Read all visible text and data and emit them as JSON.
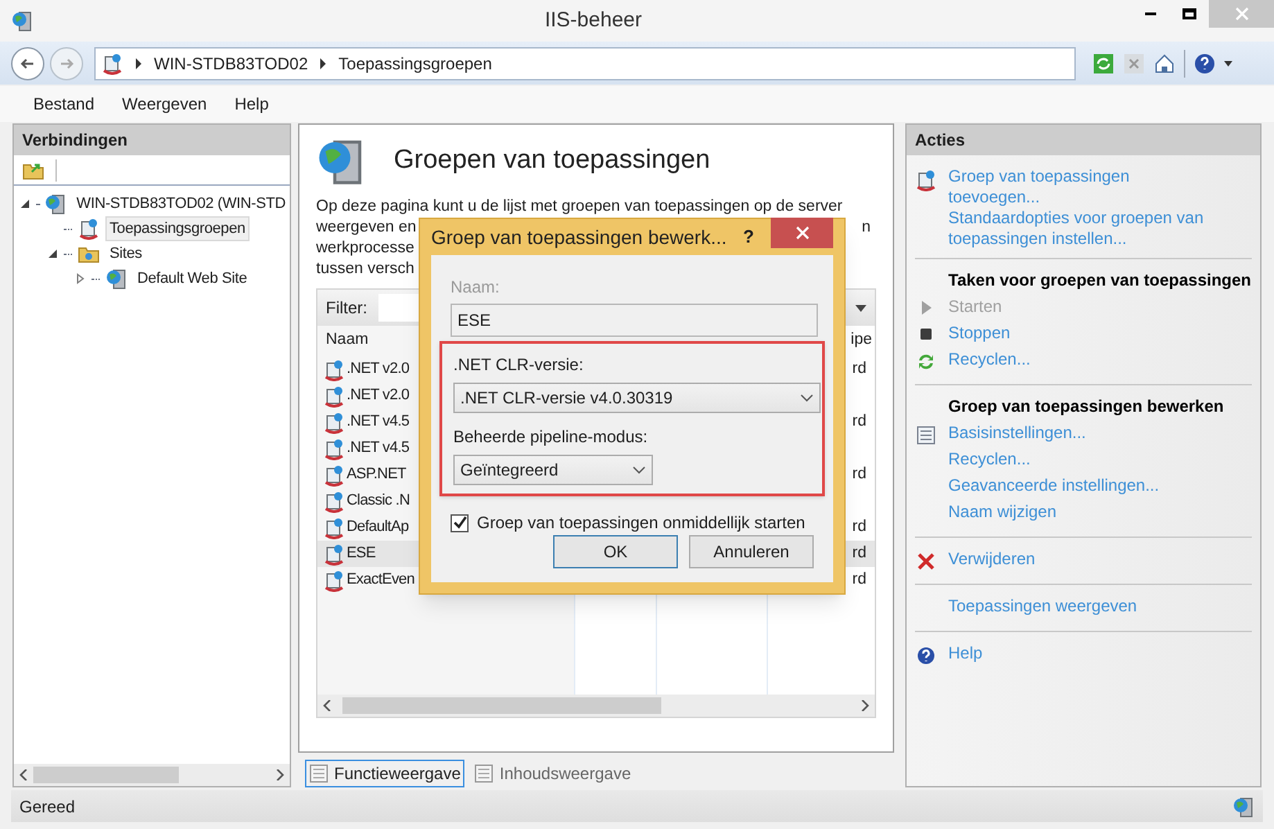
{
  "window": {
    "title": "IIS-beheer"
  },
  "address": {
    "crumbs": [
      "WIN-STDB83TOD02",
      "Toepassingsgroepen"
    ]
  },
  "menu": [
    "Bestand",
    "Weergeven",
    "Help"
  ],
  "connections": {
    "title": "Verbindingen",
    "tree": [
      {
        "label": "WIN-STDB83TOD02 (WIN-STD",
        "expanded": true,
        "selected": false,
        "children": [
          {
            "label": "Toepassingsgroepen",
            "selected": true
          },
          {
            "label": "Sites",
            "expanded": true,
            "selected": false,
            "children": [
              {
                "label": "Default Web Site",
                "expanded": false,
                "selected": false
              }
            ]
          }
        ]
      }
    ]
  },
  "main": {
    "title": "Groepen van toepassingen",
    "description": {
      "line_1": "Op deze pagina kunt u de lijst met groepen van toepassingen op de server",
      "line_2": "weergeven en",
      "line_2_end": "n",
      "line_3": "werkprocesse",
      "line_4": "tussen versch"
    },
    "filter": {
      "label": "Filter:"
    },
    "table": {
      "columns": [
        "Naam",
        "ipe"
      ],
      "rows": [
        {
          "name": ".NET v2.0",
          "column_4": "rd",
          "selected": false
        },
        {
          "name": ".NET v2.0",
          "selected": false
        },
        {
          "name": ".NET v4.5",
          "column_4": "rd",
          "selected": false
        },
        {
          "name": ".NET v4.5",
          "selected": false
        },
        {
          "name": "ASP.NET",
          "column_4": "rd",
          "selected": false
        },
        {
          "name": "Classic .N",
          "selected": false
        },
        {
          "name": "DefaultAp",
          "column_4": "rd",
          "selected": false
        },
        {
          "name": "ESE",
          "column_4": "rd",
          "selected": true
        },
        {
          "name": "ExactEven",
          "column_4": "rd",
          "selected": false
        }
      ]
    },
    "view_tabs": [
      {
        "label": "Functieweergave",
        "selected": true
      },
      {
        "label": "Inhoudsweergave",
        "selected": false
      }
    ]
  },
  "dialog": {
    "title": "Groep van toepassingen bewerk...",
    "help": "?",
    "name_label": "Naam:",
    "name_value": "ESE",
    "clr_label": ".NET CLR-versie:",
    "clr_value": ".NET CLR-versie v4.0.30319",
    "pipeline_label": "Beheerde pipeline-modus:",
    "pipeline_value": "Geïntegreerd",
    "start_checkbox": {
      "label": "Groep van toepassingen onmiddellijk starten",
      "checked": true
    },
    "buttons": [
      "OK",
      "Annuleren"
    ]
  },
  "actions": {
    "title": "Acties",
    "groups": [
      {
        "items": [
          {
            "label": "Groep van toepassingen toevoegen...",
            "kind": "link",
            "disabled": false
          },
          {
            "label": "Standaardopties voor groepen van toepassingen instellen...",
            "kind": "link",
            "disabled": false
          }
        ]
      },
      {
        "items": [
          {
            "label": "Taken voor groepen van toepassingen",
            "kind": "heading",
            "disabled": false
          },
          {
            "label": "Starten",
            "kind": "link",
            "disabled": true
          },
          {
            "label": "Stoppen",
            "kind": "link",
            "disabled": false
          },
          {
            "label": "Recyclen...",
            "kind": "link",
            "disabled": false
          }
        ]
      },
      {
        "items": [
          {
            "label": "Groep van toepassingen bewerken",
            "kind": "heading",
            "disabled": false
          },
          {
            "label": "Basisinstellingen...",
            "kind": "link",
            "disabled": false
          },
          {
            "label": "Recyclen...",
            "kind": "link",
            "disabled": false
          },
          {
            "label": "Geavanceerde instellingen...",
            "kind": "link",
            "disabled": false
          },
          {
            "label": "Naam wijzigen",
            "kind": "link",
            "disabled": false
          }
        ]
      },
      {
        "items": [
          {
            "label": "Verwijderen",
            "kind": "link",
            "disabled": false
          }
        ]
      },
      {
        "items": [
          {
            "label": "Toepassingen weergeven",
            "kind": "link",
            "disabled": false
          }
        ]
      },
      {
        "items": [
          {
            "label": "Help",
            "kind": "link",
            "disabled": false
          }
        ]
      }
    ]
  },
  "status_bar": {
    "text": "Gereed"
  }
}
